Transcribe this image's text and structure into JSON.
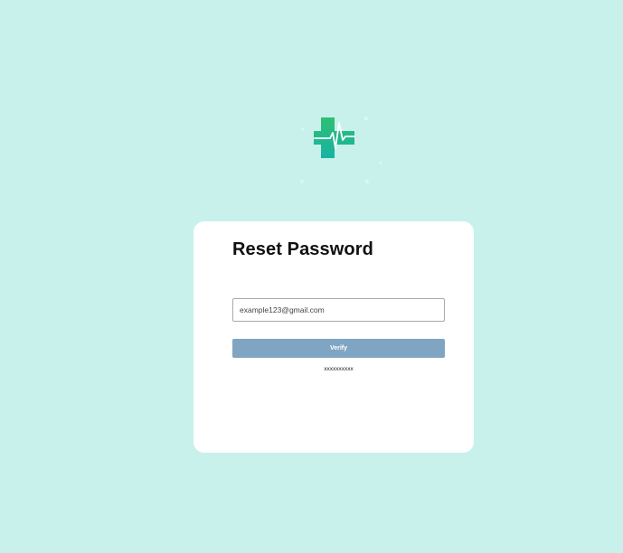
{
  "logo": {
    "icon": "medical-cross-heartbeat-icon",
    "colors": {
      "top": "#2fbf71",
      "bottom": "#16b3a4",
      "line": "#ffffff"
    }
  },
  "card": {
    "title": "Reset Password",
    "email_field": {
      "value": "example123@gmail.com"
    },
    "verify_label": "Verify",
    "footnote": "xxxxxxxxxx"
  },
  "colors": {
    "background": "#c8f1ec",
    "card": "#ffffff",
    "button": "#7fa5c2"
  }
}
